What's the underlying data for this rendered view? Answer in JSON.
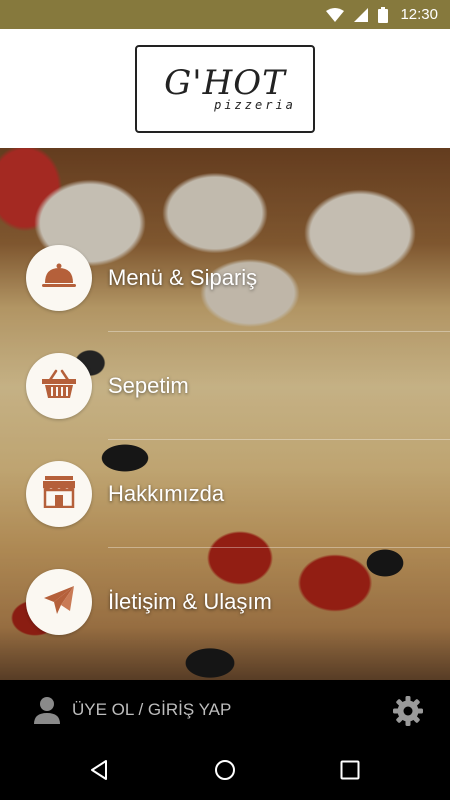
{
  "status_bar": {
    "time": "12:30",
    "icons": [
      "wifi-icon",
      "signal-icon",
      "battery-icon"
    ],
    "background": "#86793d"
  },
  "header": {
    "logo_main": "G'HOT",
    "logo_sub": "pizzeria"
  },
  "menu": {
    "items": [
      {
        "label": "Menü & Sipariş",
        "icon": "cloche-icon"
      },
      {
        "label": "Sepetim",
        "icon": "basket-icon"
      },
      {
        "label": "Hakkımızda",
        "icon": "storefront-icon"
      },
      {
        "label": "İletişim & Ulaşım",
        "icon": "paper-plane-icon"
      }
    ],
    "icon_color": "#b5603a"
  },
  "bottom_bar": {
    "login_label": "ÜYE OL / GİRİŞ YAP",
    "settings_icon": "gear-icon"
  },
  "nav_bar": {
    "buttons": [
      "back-icon",
      "home-icon",
      "recents-icon"
    ]
  }
}
